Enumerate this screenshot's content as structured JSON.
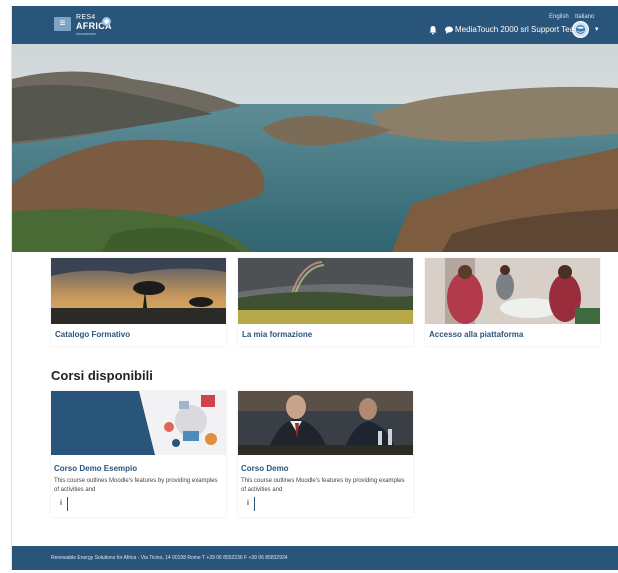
{
  "navbar": {
    "menu_icon": "hamburger-icon",
    "logo": {
      "line1": "RES4",
      "line2": "AFRICA",
      "line3": "FOUNDATION"
    },
    "languages": [
      "English",
      "Italiano"
    ],
    "notification_icon": "bell-icon",
    "messages_icon": "chat-icon",
    "user_name": "MediaTouch 2000 srl Support Team",
    "user_menu_icon": "caret-down-icon",
    "brand_color": "#2a557b"
  },
  "hero": {
    "image": "lake-landscape-photo"
  },
  "cards": [
    {
      "title": "Catalogo Formativo",
      "image": "savanna-sunset-photo"
    },
    {
      "title": "La mia formazione",
      "image": "rainbow-field-photo"
    },
    {
      "title": "Accesso alla piattaforma",
      "image": "classroom-group-photo"
    }
  ],
  "courses_section": {
    "title": "Corsi disponibili",
    "courses": [
      {
        "title": "Corso Demo Esempio",
        "summary": "This course outlines Moodle's features by providing examples of activities and",
        "info_label": "i"
      },
      {
        "title": "Corso Demo",
        "summary": "This course outlines Moodle's features by providing examples of activities and",
        "info_label": "i"
      }
    ]
  },
  "footer": {
    "text": "Renewable Energy Solutions for Africa - Via Ticino, 14 00198 Rome   T +39 06 8552236   F +39 06 85832934"
  }
}
